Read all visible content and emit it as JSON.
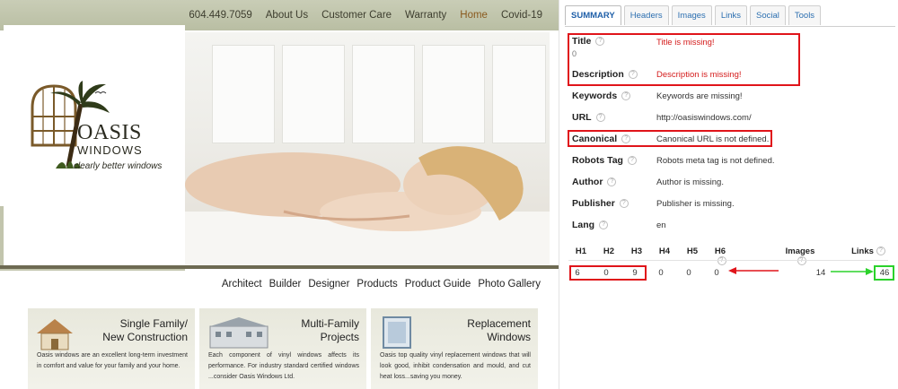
{
  "site": {
    "nav": [
      "604.449.7059",
      "About Us",
      "Customer Care",
      "Warranty",
      "Home",
      "Covid-19"
    ],
    "active_nav": "Home",
    "logo": {
      "title": "OASIS",
      "subtitle": "WINDOWS",
      "tagline": "clearly better windows"
    },
    "subnav": [
      "Architect",
      "Builder",
      "Designer",
      "Products",
      "Product Guide",
      "Photo Gallery"
    ],
    "cards": [
      {
        "title": "Single Family/\nNew Construction",
        "text": "Oasis windows are an excellent long-term investment in comfort and value for your family and your home."
      },
      {
        "title": "Multi-Family\nProjects",
        "text": "Each component of vinyl windows affects its performance. For industry standard certified windows ...consider Oasis Windows Ltd."
      },
      {
        "title": "Replacement\nWindows",
        "text": "Oasis top quality vinyl replacement windows that will look good, inhibit condensation and mould, and cut heat loss...saving you money."
      }
    ],
    "colors": {
      "header": "#c9cdb6",
      "accent": "#8a5a1e"
    }
  },
  "panel": {
    "tabs": [
      "SUMMARY",
      "Headers",
      "Images",
      "Links",
      "Social",
      "Tools"
    ],
    "active_tab": "SUMMARY",
    "title": {
      "label": "Title",
      "value": "Title is missing!",
      "count": "0"
    },
    "description": {
      "label": "Description",
      "value": "Description is missing!"
    },
    "keywords": {
      "label": "Keywords",
      "value": "Keywords are missing!"
    },
    "url": {
      "label": "URL",
      "value": "http://oasiswindows.com/"
    },
    "canonical": {
      "label": "Canonical",
      "value": "Canonical URL is not defined."
    },
    "robots": {
      "label": "Robots Tag",
      "value": "Robots meta tag is not defined."
    },
    "author": {
      "label": "Author",
      "value": "Author is missing."
    },
    "publisher": {
      "label": "Publisher",
      "value": "Publisher is missing."
    },
    "lang": {
      "label": "Lang",
      "value": "en"
    },
    "headings": {
      "labels": [
        "H1",
        "H2",
        "H3",
        "H4",
        "H5",
        "H6"
      ],
      "values": [
        "6",
        "0",
        "9",
        "0",
        "0",
        "0"
      ],
      "images_label": "Images",
      "images_value": "14",
      "links_label": "Links",
      "links_value": "46"
    },
    "colors": {
      "error": "#d41b1b",
      "highlight_red": "#e0141a",
      "highlight_green": "#2bd22b",
      "tab_link": "#2c6fb0"
    }
  }
}
